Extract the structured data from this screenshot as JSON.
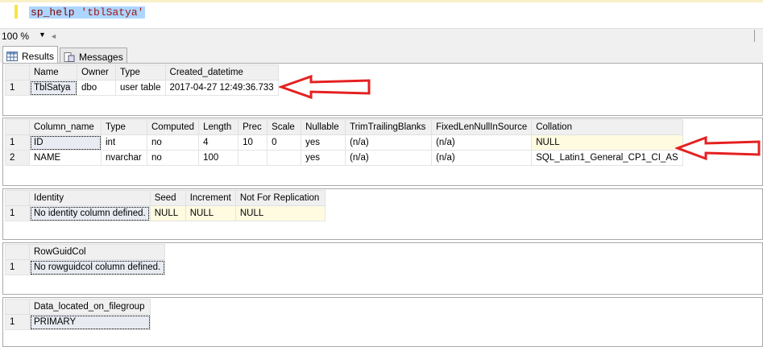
{
  "editor": {
    "query_proc": "sp_help",
    "query_arg": "'tblSatya'"
  },
  "zoom": {
    "value": "100 %"
  },
  "tabs": [
    {
      "label": "Results"
    },
    {
      "label": "Messages"
    }
  ],
  "grid1": {
    "headers": [
      "Name",
      "Owner",
      "Type",
      "Created_datetime"
    ],
    "rows": [
      [
        "1",
        "TblSatya",
        "dbo",
        "user table",
        "2017-04-27 12:49:36.733"
      ]
    ]
  },
  "grid2": {
    "headers": [
      "Column_name",
      "Type",
      "Computed",
      "Length",
      "Prec",
      "Scale",
      "Nullable",
      "TrimTrailingBlanks",
      "FixedLenNullInSource",
      "Collation"
    ],
    "rows": [
      [
        "1",
        "ID",
        "int",
        "no",
        "4",
        "10",
        "0",
        "yes",
        "(n/a)",
        "(n/a)",
        "NULL"
      ],
      [
        "2",
        "NAME",
        "nvarchar",
        "no",
        "100",
        "",
        "",
        "yes",
        "(n/a)",
        "(n/a)",
        "SQL_Latin1_General_CP1_CI_AS"
      ]
    ]
  },
  "grid3": {
    "headers": [
      "Identity",
      "Seed",
      "Increment",
      "Not For Replication"
    ],
    "rows": [
      [
        "1",
        "No identity column defined.",
        "NULL",
        "NULL",
        "NULL"
      ]
    ]
  },
  "grid4": {
    "headers": [
      "RowGuidCol"
    ],
    "rows": [
      [
        "1",
        "No rowguidcol column defined."
      ]
    ]
  },
  "grid5": {
    "headers": [
      "Data_located_on_filegroup"
    ],
    "rows": [
      [
        "1",
        "PRIMARY"
      ]
    ]
  },
  "colors": {
    "arrow": "#e52020",
    "selection": "#add6ff"
  }
}
